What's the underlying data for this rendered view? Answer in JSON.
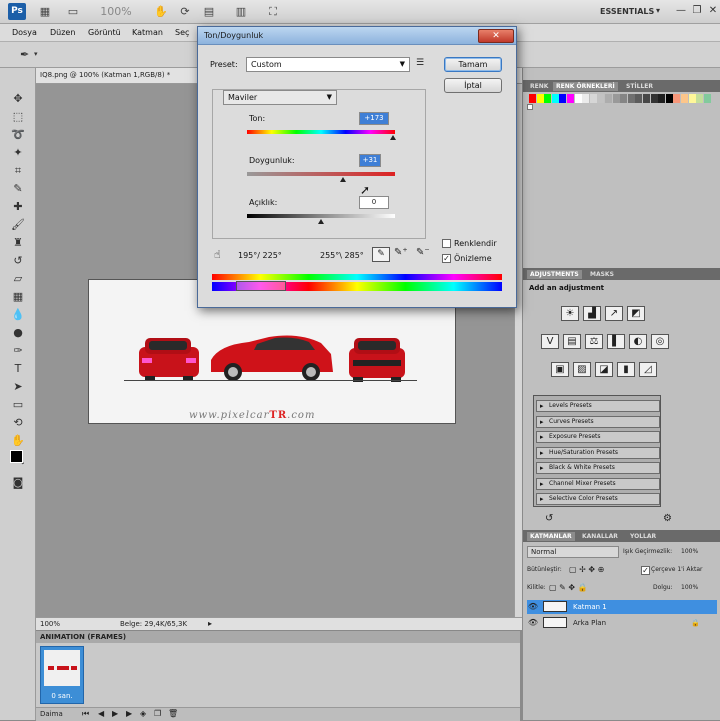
{
  "app": {
    "logo": "Ps",
    "workspace": "ESSENTIALS",
    "zoom_readout": "100%"
  },
  "menu": [
    "Dosya",
    "Düzen",
    "Görüntü",
    "Katman",
    "Seç"
  ],
  "document": {
    "tab_title": "IQ8.png @ 100% (Katman 1,RGB/8) *",
    "watermark_text": "www.pixelcar",
    "watermark_brand": "TR",
    "watermark_suffix": ".com",
    "status_zoom": "100%",
    "status_doc": "Belge: 29,4K/65,3K"
  },
  "dialog": {
    "title": "Ton/Doygunluk",
    "preset_label": "Preset:",
    "preset_value": "Custom",
    "ok_label": "Tamam",
    "cancel_label": "İptal",
    "channel": "Maviler",
    "hue_label": "Ton:",
    "hue_value": "+173",
    "saturation_label": "Doygunluk:",
    "saturation_value": "+31",
    "lightness_label": "Açıklık:",
    "lightness_value": "0",
    "range_left": "195°/ 225°",
    "range_right": "255°\\ 285°",
    "colorize_label": "Renklendir",
    "preview_label": "Önizleme",
    "preview_checked": true,
    "colorize_checked": false
  },
  "right_panel": {
    "swatch_tabs": [
      "RENK",
      "RENK ÖRNEKLERİ",
      "STİLLER"
    ],
    "swatch_colors": [
      "#ff0000",
      "#ffff00",
      "#00ff00",
      "#00ffff",
      "#0000ff",
      "#ff00ff",
      "#ffffff",
      "#ebebeb",
      "#d6d6d6",
      "#c2c2c2",
      "#adadad",
      "#999999",
      "#858585",
      "#707070",
      "#5c5c5c",
      "#474747",
      "#333333",
      "#1f1f1f",
      "#000000",
      "#f7977a",
      "#fdc68a",
      "#fff799",
      "#c4df9b",
      "#82ca9d"
    ],
    "adjust_tabs": [
      "ADJUSTMENTS",
      "MASKS"
    ],
    "adjust_heading": "Add an adjustment",
    "adjust_icons": [
      [
        "☀",
        "▟",
        "↗",
        "◩"
      ],
      [
        "V",
        "▤",
        "⚖",
        "▌",
        "◐",
        "◎"
      ],
      [
        "▣",
        "▨",
        "◪",
        "▮",
        "◿"
      ]
    ],
    "presets": [
      "Levels Presets",
      "Curves Presets",
      "Exposure Presets",
      "Hue/Saturation Presets",
      "Black & White Presets",
      "Channel Mixer Presets",
      "Selective Color Presets"
    ],
    "layer_tabs": [
      "KATMANLAR",
      "KANALLAR",
      "YOLLAR"
    ],
    "blend_mode": "Normal",
    "opacity_label": "Işık Geçirmezlik:",
    "opacity_value": "100%",
    "lock_label": "Bütünleştir:",
    "unify_label": "Çerçeve 1'i Aktar",
    "lock2_label": "Kilitle:",
    "fill_label": "Dolgu:",
    "fill_value": "100%",
    "layers": [
      {
        "name": "Katman 1",
        "selected": true
      },
      {
        "name": "Arka Plan",
        "selected": false
      }
    ]
  },
  "animation": {
    "header": "ANIMATION (FRAMES)",
    "frame_time": "0 san.",
    "loop": "Daima"
  }
}
